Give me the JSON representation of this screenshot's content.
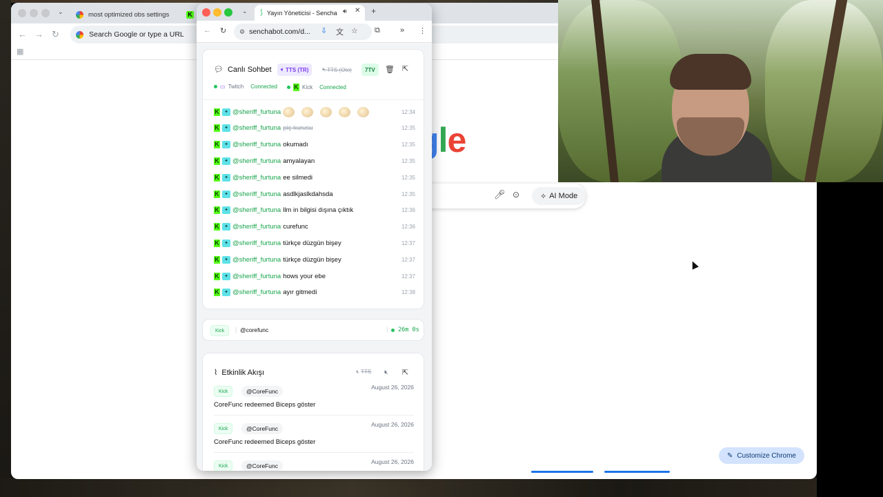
{
  "background_browser": {
    "tabs": [
      {
        "label": "most optimized obs settings",
        "icon": "google-icon"
      },
      {
        "label": "",
        "icon": "kick-icon"
      }
    ],
    "omnibox_placeholder": "Search Google or type a URL",
    "google_logo_visible": "gle",
    "ai_mode_label": "AI Mode",
    "customize_label": "Customize Chrome"
  },
  "popup": {
    "tab_title": "Yayın Yöneticisi - Sencha",
    "url": "senchabot.com/d...",
    "chat": {
      "title": "Canlı Sohbet",
      "tts_tr_label": "TTS (TR)",
      "tts_auto_label": "TTS (Oto)",
      "seven_tv_label": "7TV",
      "connections": [
        {
          "platform": "Twitch",
          "status": "Connected"
        },
        {
          "platform": "Kick",
          "status": "Connected"
        }
      ],
      "messages": [
        {
          "user": "@sheriff_furtuna",
          "text": "",
          "time": "12:34",
          "emotes": 5,
          "strike": false
        },
        {
          "user": "@sheriff_furtuna",
          "text": "piç kurusu",
          "time": "12:35",
          "emotes": 0,
          "strike": true
        },
        {
          "user": "@sheriff_furtuna",
          "text": "okumadı",
          "time": "12:35",
          "emotes": 0,
          "strike": false
        },
        {
          "user": "@sheriff_furtuna",
          "text": "amyalayan",
          "time": "12:35",
          "emotes": 0,
          "strike": false
        },
        {
          "user": "@sheriff_furtuna",
          "text": "ee silmedi",
          "time": "12:35",
          "emotes": 0,
          "strike": false
        },
        {
          "user": "@sheriff_furtuna",
          "text": "asdlkjaslkdahsda",
          "time": "12:35",
          "emotes": 0,
          "strike": false
        },
        {
          "user": "@sheriff_furtuna",
          "text": "llm in bilgisi dışına çıktık",
          "time": "12:36",
          "emotes": 0,
          "strike": false
        },
        {
          "user": "@sheriff_furtuna",
          "text": "curefunc",
          "time": "12:36",
          "emotes": 0,
          "strike": false
        },
        {
          "user": "@sheriff_furtuna",
          "text": "türkçe düzgün bişey",
          "time": "12:37",
          "emotes": 0,
          "strike": false
        },
        {
          "user": "@sheriff_furtuna",
          "text": "türkçe düzgün bişey",
          "time": "12:37",
          "emotes": 0,
          "strike": false
        },
        {
          "user": "@sheriff_furtuna",
          "text": "hows your ebe",
          "time": "12:37",
          "emotes": 0,
          "strike": false
        },
        {
          "user": "@sheriff_furtuna",
          "text": "ayır gitmedi",
          "time": "12:38",
          "emotes": 0,
          "strike": false
        }
      ]
    },
    "stream": {
      "platform": "Kick",
      "channel": "@corefunc",
      "uptime": "26m 0s"
    },
    "events": {
      "title": "Etkinlik Akışı",
      "tts_label": "TTS",
      "items": [
        {
          "platform": "Kick",
          "user": "@CoreFunc",
          "date": "August 26, 2026",
          "text": "CoreFunc redeemed Biceps göster"
        },
        {
          "platform": "Kick",
          "user": "@CoreFunc",
          "date": "August 26, 2026",
          "text": "CoreFunc redeemed Biceps göster"
        },
        {
          "platform": "Kick",
          "user": "@CoreFunc",
          "date": "August 26, 2026",
          "text": ""
        }
      ]
    }
  },
  "colors": {
    "kick_green": "#53fc18",
    "username_green": "#16a34a",
    "tts_purple": "#7c3aed",
    "customize_bg": "#d3e3fd"
  }
}
